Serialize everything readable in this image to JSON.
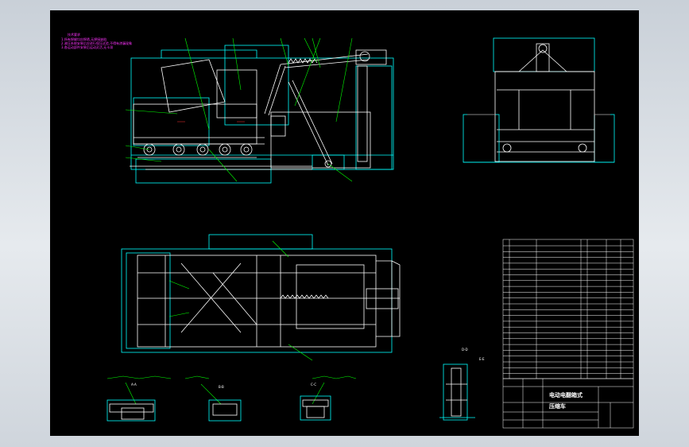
{
  "drawing": {
    "title_line1": "电动电翻箱式",
    "title_line2": "压缩车",
    "notes": {
      "title": "技术要求",
      "lines": [
        "1.所有焊缝均应焊透,无焊接缺陷",
        "2.液压系统安装后应进行保压试验,不得有渗漏现象",
        "3.各运动部件安装后运动灵活,无卡滞"
      ]
    },
    "section_labels": [
      "A-A",
      "B-B",
      "C-C",
      "D-D",
      "E-E"
    ],
    "colors": {
      "outline": "#00ffff",
      "detail": "#ffffff",
      "leader": "#00ff00",
      "notes": "#ff33ff",
      "title_block": "#ffffff"
    }
  }
}
